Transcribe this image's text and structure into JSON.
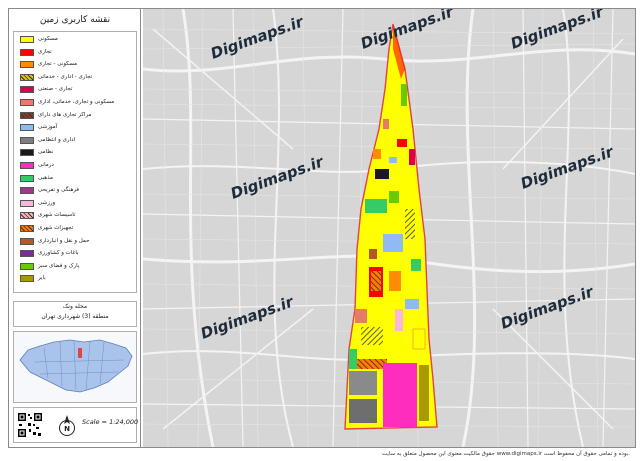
{
  "legend": {
    "title": "نقشه کاربری زمین",
    "items": [
      {
        "label": "مسکونی",
        "color": "#ffff00"
      },
      {
        "label": "تجاری",
        "color": "#ff0000"
      },
      {
        "label": "مسکونی - تجاری",
        "color": "#ff8c00"
      },
      {
        "label": "تجاری - اداری - خدماتی",
        "color": "#d9c400",
        "hatch": true
      },
      {
        "label": "تجاری - صنعتی",
        "color": "#e0004a"
      },
      {
        "label": "مسکونی و تجاری، خدماتی، اداری",
        "color": "#e87a68"
      },
      {
        "label": "مراکز تجاری های دارای",
        "color": "#8a3a2a",
        "hatch": true
      },
      {
        "label": "آموزشی",
        "color": "#8fbaf2"
      },
      {
        "label": "اداری و انتظامی",
        "color": "#7e7e7e"
      },
      {
        "label": "نظامی",
        "color": "#1a1a1a"
      },
      {
        "label": "درمانی",
        "color": "#ff2dbe"
      },
      {
        "label": "مذهبی",
        "color": "#33cc66"
      },
      {
        "label": "فرهنگی و تفریحی",
        "color": "#9a3a8a"
      },
      {
        "label": "ورزشی",
        "color": "#f5b7dc"
      },
      {
        "label": "تاسیسات شهری",
        "color": "#ffb3b3",
        "hatch": true
      },
      {
        "label": "تجهیزات شهری",
        "color": "#ff7a00",
        "hatch": true
      },
      {
        "label": "حمل و نقل و انبارداری",
        "color": "#b05a2a"
      },
      {
        "label": "باغات و کشاورزی",
        "color": "#7a2a9a"
      },
      {
        "label": "پارک و فضای سبز",
        "color": "#66cc00"
      },
      {
        "label": "بایر",
        "color": "#a89a00"
      }
    ]
  },
  "region": {
    "title": "محله ونک",
    "subtitle": "منطقه (3) شهرداری تهران"
  },
  "scale": "Scale = 1:24,000",
  "north_label": "N",
  "watermark": "Digimaps.ir",
  "footer": "حقوق مالکیت معنوی این محصول متعلق به سایت www.digimaps.ir بوده و تمامی حقوق آن محفوظ است.",
  "colors": {
    "map_background": "#d6d6d6",
    "boundary": "#e0444a",
    "residential": "#ffff00",
    "minimap_region": "#a9c3ea"
  }
}
